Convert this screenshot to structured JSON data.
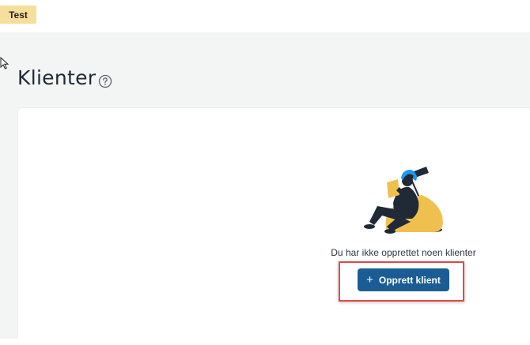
{
  "header": {
    "env_badge": "Test"
  },
  "page": {
    "title": "Klienter",
    "help_icon": "question-circle-icon"
  },
  "empty_state": {
    "illustration": "person-reading-illustration",
    "message": "Du har ikke opprettet noen klienter",
    "create_button": {
      "icon": "plus-icon",
      "label": "Opprett klient"
    }
  },
  "colors": {
    "badge_bg": "#f5df9a",
    "page_bg": "#f3f4f4",
    "primary": "#1b5c94",
    "highlight": "#e04a4a",
    "illustration_accent": "#f0c04f",
    "illustration_hair": "#2196f3"
  }
}
